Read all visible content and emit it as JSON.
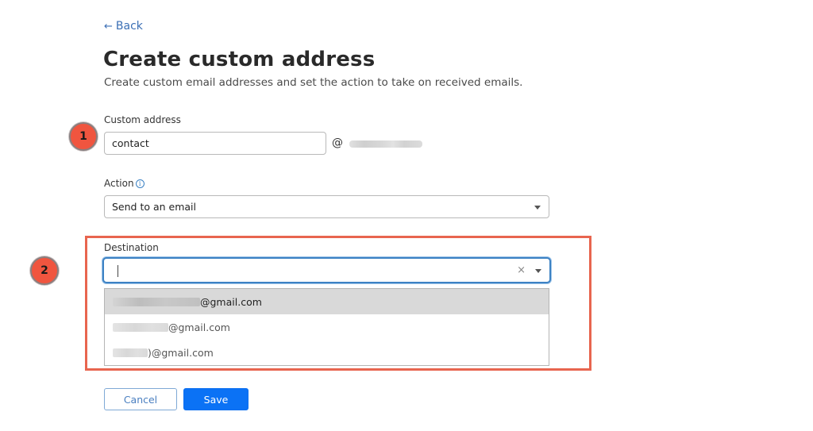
{
  "header": {
    "back_label": "Back",
    "title": "Create custom address",
    "subtitle": "Create custom email addresses and set the action to take on received emails."
  },
  "custom_address": {
    "label": "Custom address",
    "value": "contact",
    "at": "@",
    "domain": "[redacted]"
  },
  "action": {
    "label": "Action",
    "info_icon": "info-icon",
    "selected": "Send to an email"
  },
  "destination": {
    "label": "Destination",
    "value": "",
    "clear_icon": "×",
    "options": [
      {
        "suffix": "@gmail.com",
        "highlighted": true
      },
      {
        "suffix": "@gmail.com",
        "highlighted": false
      },
      {
        "suffix": ")@gmail.com",
        "highlighted": false
      }
    ]
  },
  "annotations": {
    "badge_1": "1",
    "badge_2": "2",
    "highlight_color": "#e8654f",
    "badge_color": "#f0553f"
  },
  "buttons": {
    "cancel_label": "Cancel",
    "save_label": "Save",
    "save_color": "#0b72f5"
  }
}
